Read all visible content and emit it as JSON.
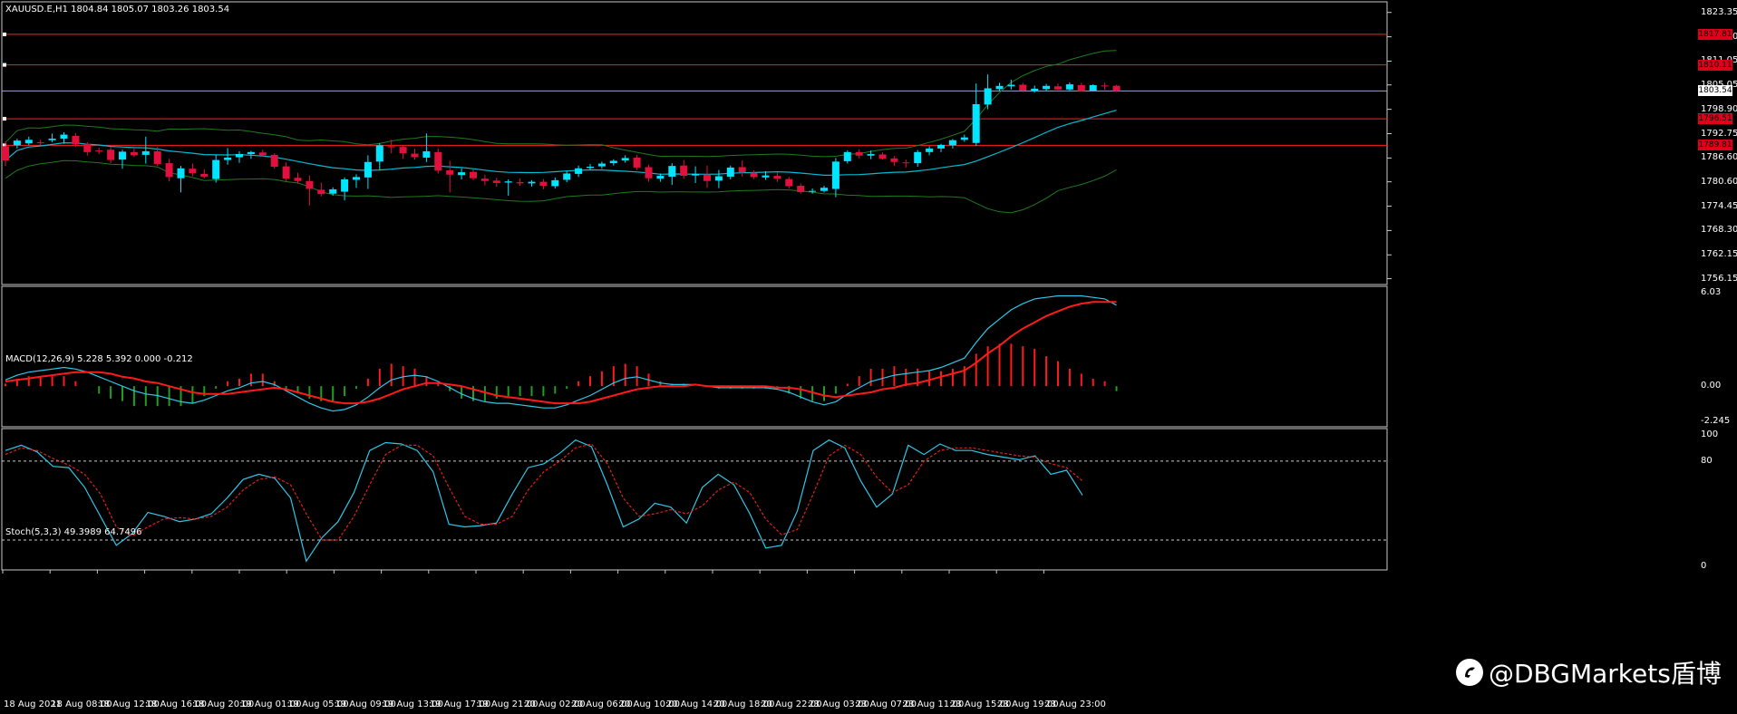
{
  "colors": {
    "background": "#000000",
    "frame": "#c8c8c8",
    "bull": "#00e5ff",
    "bear": "#e0113c",
    "band": "#1f7a1f",
    "ma": "#00bcd4",
    "hline": "#ff2020",
    "macd_signal": "#ff1a1a",
    "macd_main": "#2ec7e8",
    "hist_pos": "#ff1a1a",
    "hist_neg": "#1f9e1f",
    "stoch_main": "#2ec7e8",
    "stoch_signal": "#e0201a",
    "level_line": "#cccccc"
  },
  "main": {
    "title": "XAUUSD.E,H1  1804.84 1805.07 1803.26 1803.54",
    "yticks": [
      "1823.35",
      "1817.20",
      "1811.05",
      "1805.05",
      "1798.90",
      "1792.75",
      "1786.60",
      "1780.60",
      "1774.45",
      "1768.30",
      "1762.15",
      "1756.15"
    ],
    "ytick_values": [
      1823.35,
      1817.2,
      1811.05,
      1805.05,
      1798.9,
      1792.75,
      1786.6,
      1780.6,
      1774.45,
      1768.3,
      1762.15,
      1756.15
    ],
    "ylim": [
      1754.9,
      1825.8
    ],
    "hlines": [
      {
        "label": "1817.81",
        "value": 1817.81
      },
      {
        "label": "1810.11",
        "value": 1810.11
      },
      {
        "label": "1796.51",
        "value": 1796.51
      },
      {
        "label": "1789.81",
        "value": 1789.81
      }
    ],
    "current": {
      "label": "1803.54",
      "value": 1803.54
    }
  },
  "macd": {
    "title": "MACD(12,26,9) 5.228 5.392 0.000 -0.212",
    "yticks": [
      "6.03",
      "0.00",
      "-2.245"
    ],
    "ytick_values": [
      6.03,
      0.0,
      -2.245
    ],
    "ylim": [
      -2.55,
      6.35
    ]
  },
  "stoch": {
    "title": "Stoch(5,3,3) 49.3989 64.7496",
    "yticks": [
      "100",
      "80",
      "0"
    ],
    "ytick_values": [
      100,
      80,
      0
    ],
    "levels": [
      80,
      20
    ],
    "ylim": [
      -2,
      104
    ]
  },
  "xaxis": {
    "labels": [
      "18 Aug 2021",
      "18 Aug 08:00",
      "18 Aug 12:00",
      "18 Aug 16:00",
      "18 Aug 20:00",
      "19 Aug 01:00",
      "19 Aug 05:00",
      "19 Aug 09:00",
      "19 Aug 13:00",
      "19 Aug 17:00",
      "19 Aug 21:00",
      "20 Aug 02:00",
      "20 Aug 06:00",
      "20 Aug 10:00",
      "20 Aug 14:00",
      "20 Aug 18:00",
      "20 Aug 22:00",
      "23 Aug 03:00",
      "23 Aug 07:00",
      "23 Aug 11:00",
      "23 Aug 15:00",
      "23 Aug 19:00",
      "23 Aug 23:00"
    ]
  },
  "watermark": {
    "text": "@DBGMarkets盾博"
  },
  "chart_data": [
    {
      "type": "candlestick",
      "title": "XAUUSD.E,H1  1804.84 1805.07 1803.26 1803.54",
      "xlabel": "",
      "ylabel": "",
      "ylim": [
        1754.9,
        1825.8
      ],
      "ohlc": [
        [
          1789.6,
          1790.8,
          1784.6,
          1786.0
        ],
        [
          1789.8,
          1791.5,
          1789.0,
          1791.0
        ],
        [
          1790.3,
          1792.0,
          1789.8,
          1791.2
        ],
        [
          1790.6,
          1791.2,
          1789.8,
          1790.4
        ],
        [
          1791.1,
          1792.8,
          1790.6,
          1791.5
        ],
        [
          1791.5,
          1793.1,
          1790.2,
          1792.5
        ],
        [
          1792.2,
          1792.9,
          1789.4,
          1790.1
        ],
        [
          1790.2,
          1790.6,
          1787.2,
          1788.1
        ],
        [
          1788.5,
          1789.2,
          1787.6,
          1788.3
        ],
        [
          1788.7,
          1789.3,
          1785.3,
          1786.1
        ],
        [
          1786.2,
          1788.7,
          1783.9,
          1788.2
        ],
        [
          1788.1,
          1789.4,
          1786.9,
          1787.3
        ],
        [
          1787.4,
          1792.0,
          1785.2,
          1788.3
        ],
        [
          1788.3,
          1789.4,
          1784.6,
          1785.1
        ],
        [
          1785.3,
          1786.4,
          1780.7,
          1781.8
        ],
        [
          1781.5,
          1784.6,
          1777.9,
          1784.0
        ],
        [
          1783.9,
          1785.2,
          1782.0,
          1782.8
        ],
        [
          1782.6,
          1783.8,
          1781.5,
          1781.9
        ],
        [
          1781.3,
          1787.4,
          1780.4,
          1786.1
        ],
        [
          1786.1,
          1789.1,
          1784.9,
          1786.7
        ],
        [
          1786.8,
          1788.3,
          1785.4,
          1787.6
        ],
        [
          1787.6,
          1788.4,
          1786.4,
          1788.1
        ],
        [
          1788.0,
          1788.7,
          1786.9,
          1787.3
        ],
        [
          1787.4,
          1787.8,
          1783.9,
          1784.4
        ],
        [
          1784.5,
          1785.5,
          1780.6,
          1781.4
        ],
        [
          1781.6,
          1782.9,
          1780.1,
          1780.8
        ],
        [
          1780.8,
          1782.2,
          1774.6,
          1778.8
        ],
        [
          1778.6,
          1780.4,
          1776.9,
          1777.5
        ],
        [
          1777.6,
          1779.2,
          1777.1,
          1778.7
        ],
        [
          1778.1,
          1781.7,
          1775.9,
          1781.2
        ],
        [
          1781.1,
          1782.5,
          1779.1,
          1781.8
        ],
        [
          1781.7,
          1787.3,
          1778.8,
          1785.6
        ],
        [
          1785.7,
          1790.4,
          1783.6,
          1789.8
        ],
        [
          1789.6,
          1791.2,
          1787.8,
          1789.3
        ],
        [
          1789.4,
          1789.8,
          1786.4,
          1787.8
        ],
        [
          1787.7,
          1788.9,
          1786.2,
          1786.8
        ],
        [
          1786.7,
          1792.8,
          1785.6,
          1788.3
        ],
        [
          1788.1,
          1789.0,
          1782.7,
          1783.4
        ],
        [
          1783.5,
          1785.9,
          1777.9,
          1782.4
        ],
        [
          1782.3,
          1784.0,
          1781.2,
          1783.0
        ],
        [
          1783.1,
          1783.8,
          1781.0,
          1781.5
        ],
        [
          1781.4,
          1782.4,
          1779.7,
          1780.8
        ],
        [
          1780.9,
          1781.6,
          1779.3,
          1780.3
        ],
        [
          1780.4,
          1781.2,
          1777.1,
          1780.7
        ],
        [
          1780.5,
          1781.5,
          1779.6,
          1780.2
        ],
        [
          1780.2,
          1781.0,
          1779.4,
          1780.6
        ],
        [
          1780.6,
          1781.3,
          1778.7,
          1779.6
        ],
        [
          1779.5,
          1781.7,
          1778.9,
          1781.0
        ],
        [
          1781.1,
          1783.4,
          1780.5,
          1782.7
        ],
        [
          1782.6,
          1784.7,
          1781.8,
          1784.0
        ],
        [
          1784.1,
          1785.1,
          1783.5,
          1784.4
        ],
        [
          1784.5,
          1785.7,
          1783.9,
          1785.2
        ],
        [
          1785.3,
          1786.3,
          1784.7,
          1785.9
        ],
        [
          1786.0,
          1787.3,
          1785.4,
          1786.6
        ],
        [
          1786.7,
          1787.4,
          1783.6,
          1784.2
        ],
        [
          1784.3,
          1784.9,
          1780.6,
          1781.5
        ],
        [
          1781.4,
          1782.7,
          1780.6,
          1782.1
        ],
        [
          1781.9,
          1785.3,
          1779.8,
          1784.6
        ],
        [
          1784.7,
          1786.1,
          1781.4,
          1782.1
        ],
        [
          1782.2,
          1784.5,
          1780.3,
          1782.6
        ],
        [
          1782.4,
          1784.7,
          1779.1,
          1780.8
        ],
        [
          1780.9,
          1783.6,
          1779.0,
          1782.0
        ],
        [
          1781.9,
          1784.7,
          1781.2,
          1784.2
        ],
        [
          1784.3,
          1786.0,
          1781.9,
          1783.0
        ],
        [
          1782.9,
          1783.5,
          1781.3,
          1781.8
        ],
        [
          1781.7,
          1783.3,
          1781.1,
          1782.2
        ],
        [
          1782.1,
          1782.9,
          1780.6,
          1781.4
        ],
        [
          1781.3,
          1781.8,
          1778.9,
          1779.5
        ],
        [
          1779.6,
          1780.2,
          1777.6,
          1778.0
        ],
        [
          1778.2,
          1778.9,
          1777.6,
          1778.3
        ],
        [
          1778.3,
          1779.6,
          1777.9,
          1779.1
        ],
        [
          1778.8,
          1786.6,
          1776.7,
          1785.7
        ],
        [
          1785.8,
          1788.5,
          1785.2,
          1788.1
        ],
        [
          1788.1,
          1788.8,
          1786.5,
          1787.2
        ],
        [
          1787.2,
          1788.5,
          1786.3,
          1787.6
        ],
        [
          1787.5,
          1788.0,
          1786.2,
          1786.4
        ],
        [
          1786.5,
          1787.1,
          1784.6,
          1785.6
        ],
        [
          1785.5,
          1786.2,
          1784.2,
          1785.3
        ],
        [
          1785.3,
          1788.6,
          1784.4,
          1788.1
        ],
        [
          1788.1,
          1789.6,
          1787.3,
          1789.0
        ],
        [
          1789.0,
          1790.2,
          1788.1,
          1789.9
        ],
        [
          1789.8,
          1791.4,
          1789.0,
          1791.1
        ],
        [
          1791.2,
          1792.5,
          1790.7,
          1791.8
        ],
        [
          1790.4,
          1805.4,
          1789.6,
          1800.2
        ],
        [
          1800.1,
          1807.7,
          1798.9,
          1804.2
        ],
        [
          1804.0,
          1805.6,
          1803.6,
          1804.8
        ],
        [
          1804.7,
          1806.4,
          1803.9,
          1805.1
        ],
        [
          1805.1,
          1805.6,
          1803.2,
          1803.6
        ],
        [
          1803.5,
          1804.9,
          1803.1,
          1804.1
        ],
        [
          1804.0,
          1805.3,
          1803.6,
          1804.8
        ],
        [
          1804.7,
          1805.4,
          1803.8,
          1803.9
        ],
        [
          1803.9,
          1805.7,
          1803.7,
          1805.2
        ],
        [
          1805.0,
          1805.6,
          1803.4,
          1803.5
        ],
        [
          1803.6,
          1805.2,
          1803.6,
          1805.0
        ],
        [
          1804.9,
          1805.6,
          1803.8,
          1804.8
        ],
        [
          1804.84,
          1805.07,
          1803.26,
          1803.54
        ]
      ]
    },
    {
      "type": "line",
      "title": "MACD(12,26,9) 5.228 5.392 0.000 -0.212",
      "ylim": [
        -2.55,
        6.35
      ],
      "series": [
        {
          "name": "MACD",
          "values": [
            0.4,
            0.7,
            0.9,
            1.0,
            1.1,
            1.2,
            1.1,
            0.9,
            0.6,
            0.3,
            0.0,
            -0.3,
            -0.5,
            -0.6,
            -0.8,
            -1.0,
            -1.1,
            -0.9,
            -0.6,
            -0.3,
            -0.1,
            0.2,
            0.3,
            0.1,
            -0.3,
            -0.7,
            -1.1,
            -1.4,
            -1.6,
            -1.5,
            -1.2,
            -0.7,
            -0.1,
            0.4,
            0.6,
            0.7,
            0.6,
            0.3,
            -0.1,
            -0.5,
            -0.8,
            -1.0,
            -1.1,
            -1.1,
            -1.2,
            -1.3,
            -1.4,
            -1.4,
            -1.2,
            -0.9,
            -0.6,
            -0.2,
            0.2,
            0.5,
            0.6,
            0.4,
            0.2,
            0.1,
            0.1,
            0.1,
            0.0,
            -0.1,
            -0.1,
            -0.1,
            -0.1,
            -0.1,
            -0.2,
            -0.4,
            -0.7,
            -1.0,
            -1.2,
            -1.0,
            -0.5,
            -0.1,
            0.3,
            0.5,
            0.7,
            0.8,
            0.9,
            1.0,
            1.2,
            1.5,
            1.8,
            2.8,
            3.7,
            4.3,
            4.9,
            5.3,
            5.6,
            5.7,
            5.8,
            5.8,
            5.8,
            5.7,
            5.6,
            5.2
          ]
        },
        {
          "name": "Signal",
          "values": [
            0.3,
            0.4,
            0.5,
            0.6,
            0.7,
            0.8,
            0.9,
            0.9,
            0.9,
            0.8,
            0.6,
            0.5,
            0.3,
            0.2,
            0.0,
            -0.2,
            -0.4,
            -0.5,
            -0.5,
            -0.5,
            -0.4,
            -0.3,
            -0.2,
            -0.1,
            -0.2,
            -0.4,
            -0.6,
            -0.8,
            -1.0,
            -1.1,
            -1.1,
            -1.0,
            -0.8,
            -0.5,
            -0.2,
            0.0,
            0.2,
            0.2,
            0.1,
            0.0,
            -0.2,
            -0.4,
            -0.6,
            -0.7,
            -0.8,
            -0.9,
            -1.0,
            -1.1,
            -1.1,
            -1.1,
            -1.0,
            -0.8,
            -0.6,
            -0.4,
            -0.2,
            -0.1,
            0.0,
            0.0,
            0.0,
            0.1,
            0.0,
            0.0,
            0.0,
            0.0,
            0.0,
            0.0,
            -0.1,
            -0.1,
            -0.2,
            -0.4,
            -0.6,
            -0.7,
            -0.6,
            -0.5,
            -0.4,
            -0.2,
            -0.1,
            0.1,
            0.2,
            0.4,
            0.6,
            0.8,
            1.0,
            1.5,
            2.1,
            2.6,
            3.2,
            3.7,
            4.1,
            4.5,
            4.8,
            5.1,
            5.3,
            5.4,
            5.4,
            5.4
          ]
        }
      ]
    },
    {
      "type": "line",
      "title": "Stoch(5,3,3) 49.3989 64.7496",
      "ylim": [
        -2,
        104
      ],
      "series": [
        {
          "name": "Main",
          "values": [
            88,
            92,
            87,
            76,
            75,
            60,
            38,
            16,
            25,
            41,
            38,
            34,
            36,
            40,
            52,
            66,
            70,
            67,
            52,
            4,
            22,
            34,
            56,
            88,
            94,
            93,
            88,
            72,
            32,
            30,
            31,
            33,
            55,
            75,
            78,
            86,
            96,
            91,
            62,
            30,
            36,
            48,
            45,
            33,
            60,
            70,
            62,
            40,
            14,
            16,
            42,
            88,
            96,
            90,
            65,
            45,
            55,
            92,
            85,
            93,
            88,
            88,
            85,
            83,
            81,
            84,
            70,
            73,
            54
          ]
        },
        {
          "name": "Signal",
          "values": [
            85,
            90,
            88,
            82,
            77,
            70,
            55,
            30,
            23,
            30,
            36,
            37,
            36,
            38,
            45,
            58,
            66,
            68,
            62,
            40,
            20,
            20,
            38,
            62,
            85,
            92,
            92,
            84,
            60,
            38,
            32,
            32,
            38,
            58,
            72,
            80,
            90,
            93,
            78,
            52,
            38,
            40,
            43,
            40,
            46,
            58,
            64,
            56,
            36,
            24,
            28,
            55,
            84,
            92,
            85,
            68,
            56,
            62,
            80,
            88,
            90,
            90,
            88,
            86,
            84,
            83,
            78,
            75,
            65
          ]
        }
      ]
    }
  ]
}
